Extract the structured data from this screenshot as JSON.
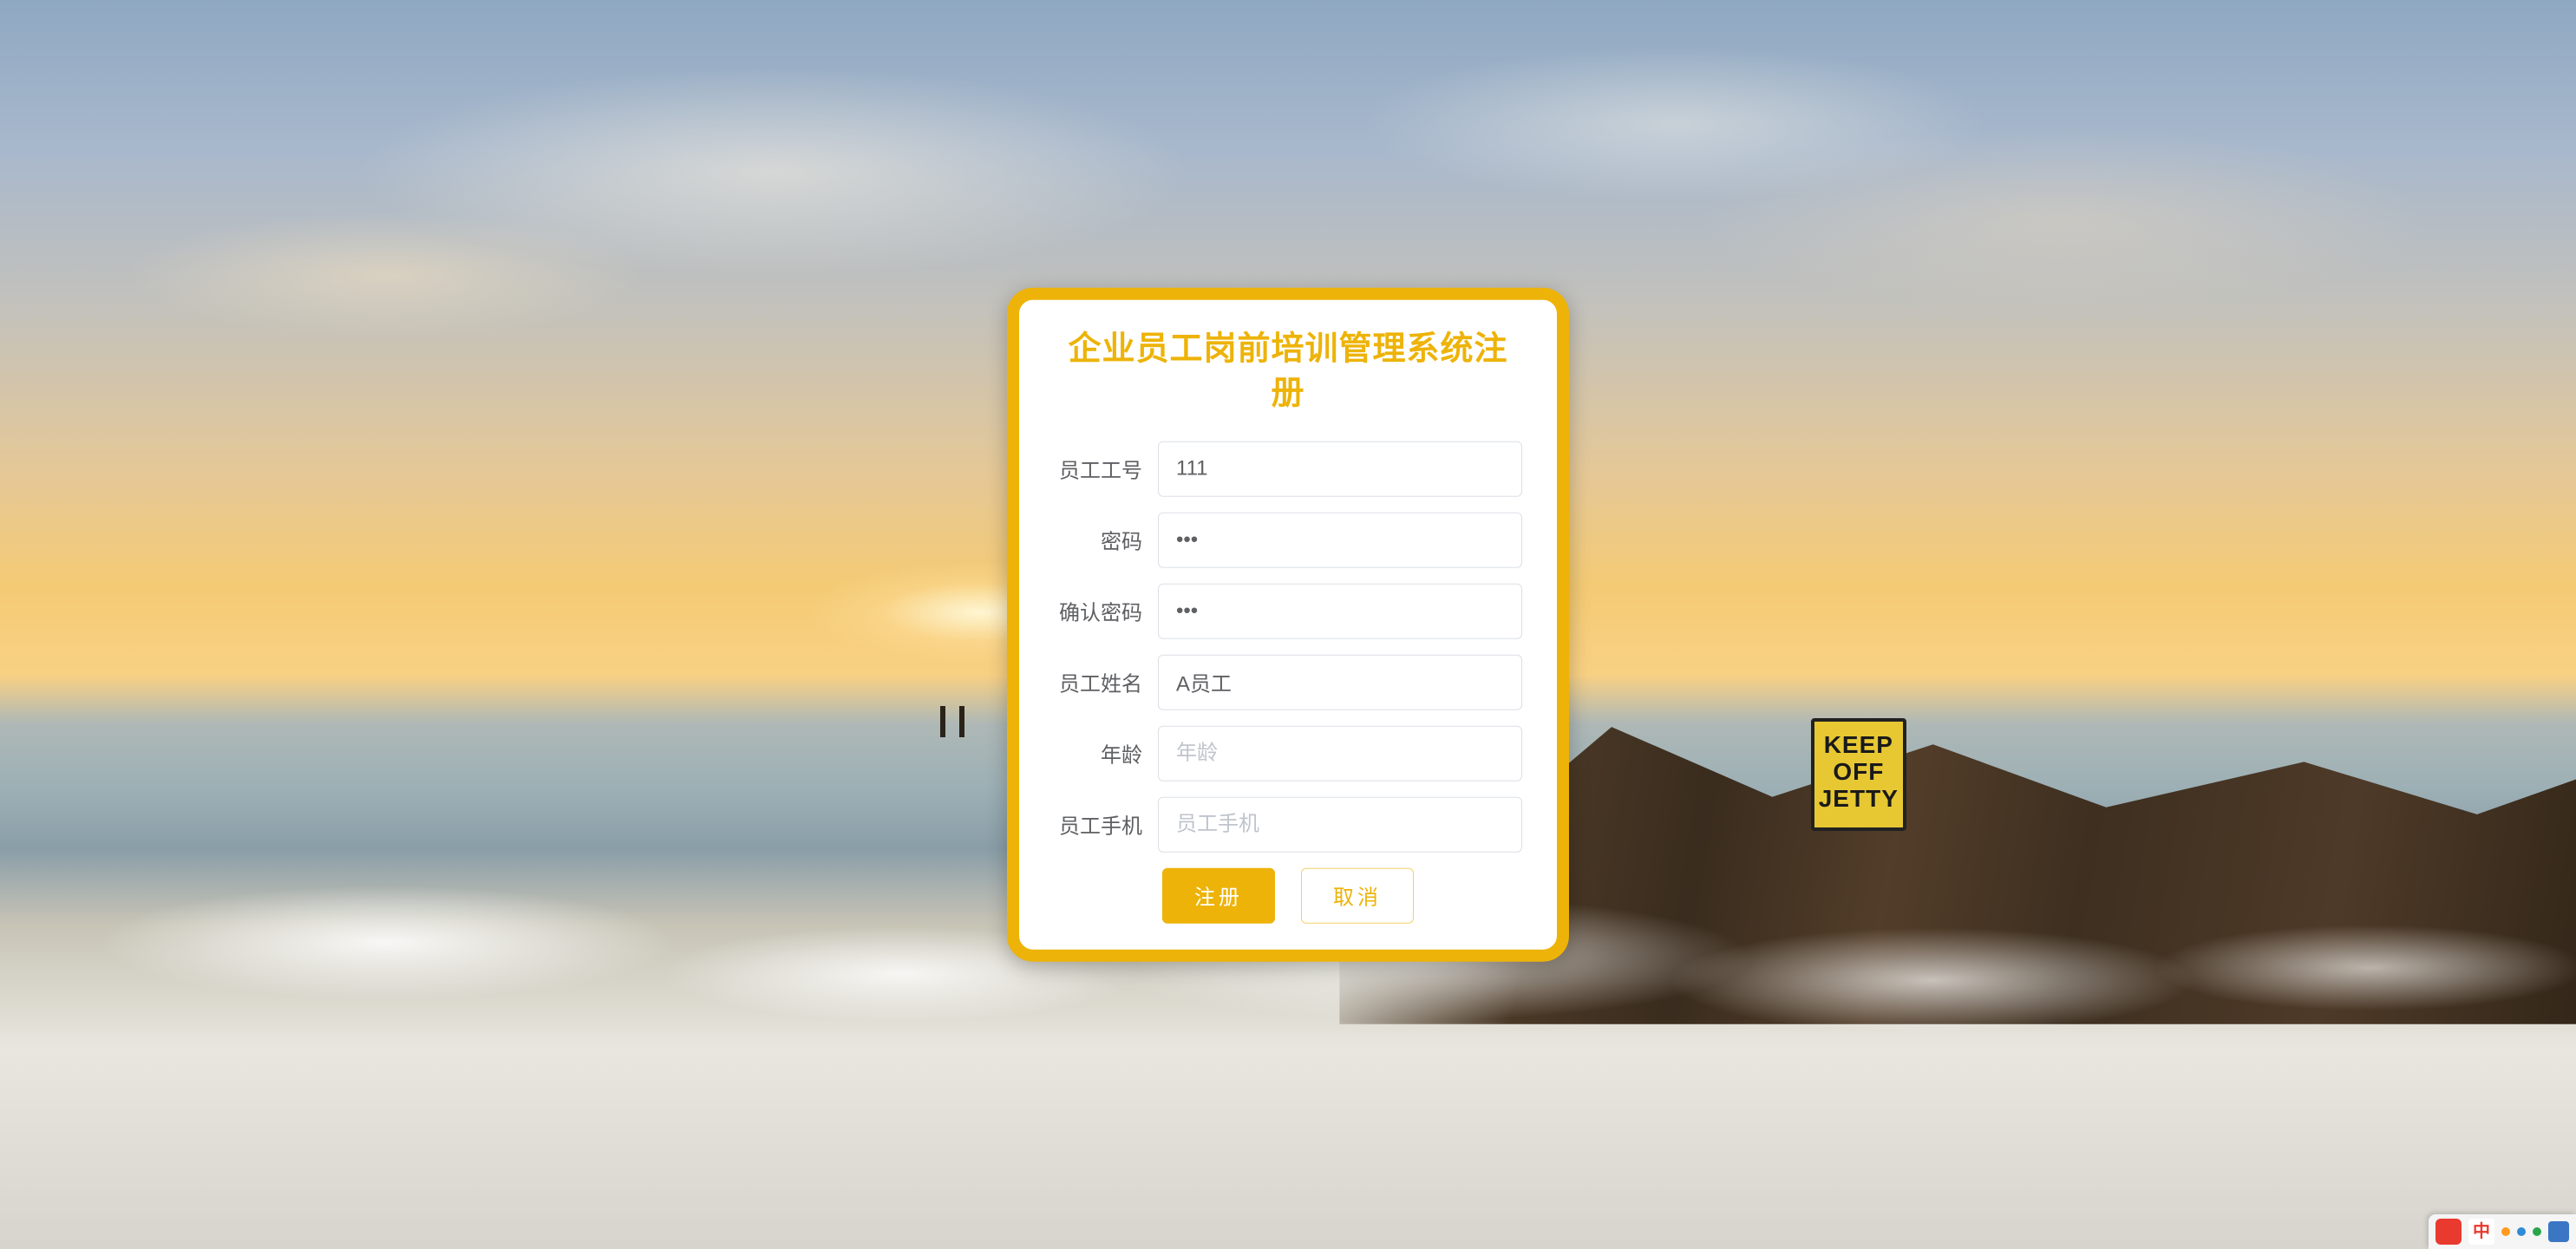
{
  "title": "企业员工岗前培训管理系统注册",
  "fields": {
    "employee_id": {
      "label": "员工工号",
      "value": "111",
      "placeholder": "员工工号"
    },
    "password": {
      "label": "密码",
      "value": "•••",
      "placeholder": "密码"
    },
    "confirm": {
      "label": "确认密码",
      "value": "•••",
      "placeholder": "确认密码"
    },
    "name": {
      "label": "员工姓名",
      "value": "A员工",
      "placeholder": "员工姓名"
    },
    "age": {
      "label": "年龄",
      "value": "",
      "placeholder": "年龄"
    },
    "phone": {
      "label": "员工手机",
      "value": "",
      "placeholder": "员工手机"
    }
  },
  "buttons": {
    "register": "注册",
    "cancel": "取消"
  },
  "ime": {
    "lang": "中"
  },
  "colors": {
    "accent": "#edb308"
  }
}
